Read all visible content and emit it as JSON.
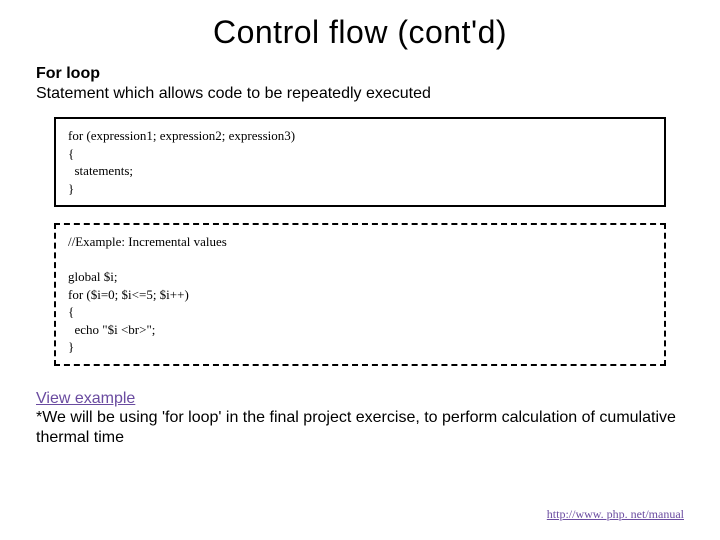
{
  "title": "Control flow (cont'd)",
  "subheading": "For loop",
  "description": "Statement which allows code to be repeatedly executed",
  "syntax_block": "for (expression1; expression2; expression3)\n{\n  statements;\n}",
  "example_block": "//Example: Incremental values\n\nglobal $i;\nfor ($i=0; $i<=5; $i++)\n{\n  echo \"$i <br>\";\n}",
  "view_example_label": "View example",
  "note_text": "*We will be using 'for loop' in the final project exercise, to perform calculation of cumulative thermal time",
  "footer_link": "http://www. php. net/manual"
}
